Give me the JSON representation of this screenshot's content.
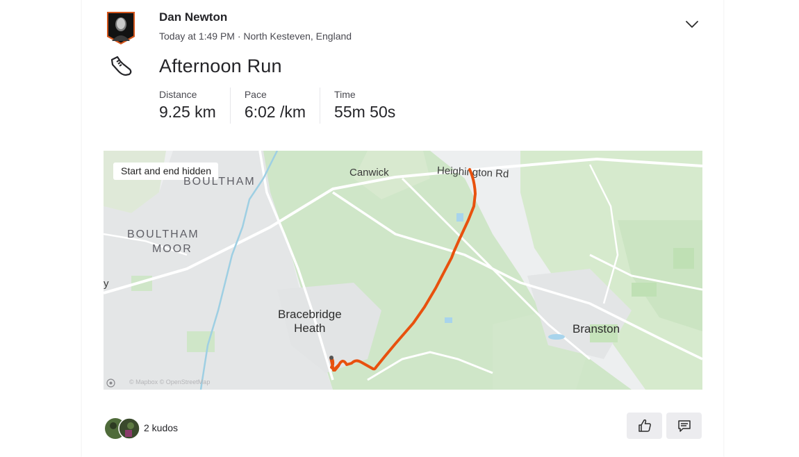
{
  "athlete": {
    "name": "Dan Newton",
    "meta": "Today at 1:49 PM · North Kesteven, England"
  },
  "icons": {
    "menu": "chevron-down-icon",
    "sport": "run-shoe-icon",
    "kudos": "thumbs-up-icon",
    "comment": "comment-icon",
    "mapbox": "mapbox-logo"
  },
  "activity": {
    "title": "Afternoon Run",
    "stats": [
      {
        "label": "Distance",
        "value": "9.25 km"
      },
      {
        "label": "Pace",
        "value": "6:02 /km"
      },
      {
        "label": "Time",
        "value": "55m 50s"
      }
    ]
  },
  "map": {
    "badge": "Start and end hidden",
    "labels": {
      "boultham": "BOULTHAM",
      "boultham_moor_1": "BOULTHAM",
      "boultham_moor_2": "MOOR",
      "canwick": "Canwick",
      "heighington_rd": "Heighington Rd",
      "bracebridge_1": "Bracebridge",
      "bracebridge_2": "Heath",
      "branston": "Branston",
      "edge_fragment": "y"
    },
    "attribution": "© Mapbox © OpenStreetMap",
    "route_color": "#e8510e"
  },
  "social": {
    "kudos": "2 kudos"
  },
  "colors": {
    "accent": "#fc5200",
    "text": "#242428",
    "muted": "#494950"
  }
}
